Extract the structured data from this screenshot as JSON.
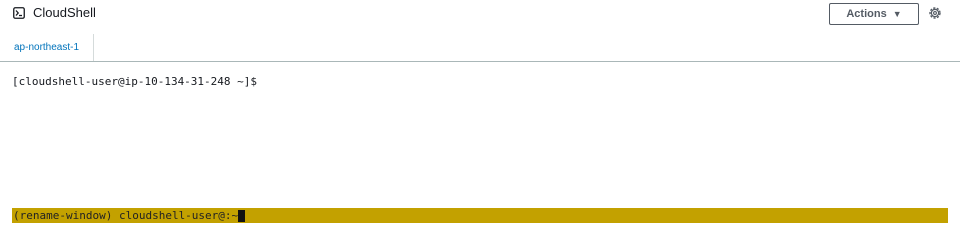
{
  "header": {
    "title": "CloudShell",
    "actions_label": "Actions",
    "actions_caret": "▼"
  },
  "icons": {
    "terminal": "terminal-icon",
    "settings": "gear-icon"
  },
  "tabs": [
    {
      "label": "ap-northeast-1",
      "active": true
    }
  ],
  "terminal": {
    "prompt": "[cloudshell-user@ip-10-134-31-248 ~]$",
    "status_line": "(rename-window) cloudshell-user@:~"
  },
  "colors": {
    "tab_active": "#0073bb",
    "status_bar": "#c3a100",
    "text": "#16191f"
  }
}
